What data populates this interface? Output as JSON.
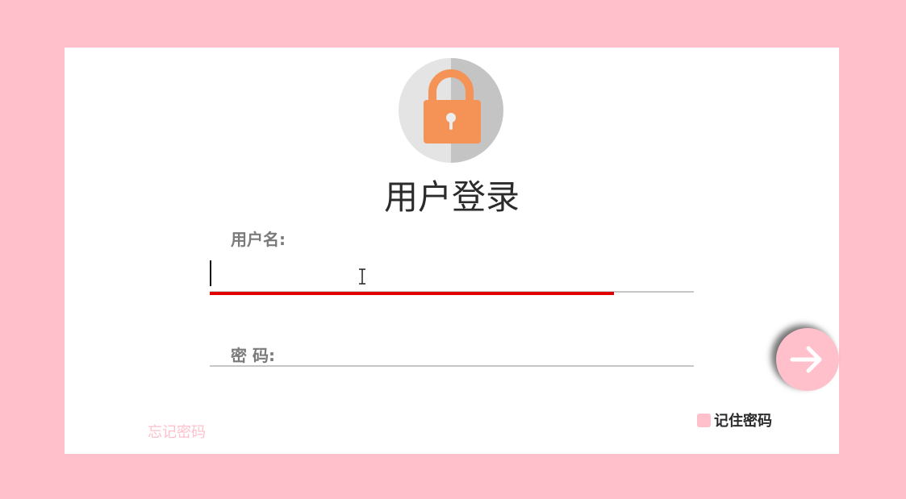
{
  "login": {
    "title": "用户登录",
    "username_label": "用户名:",
    "username_value": "",
    "username_placeholder": "",
    "password_label": "密 码:",
    "password_value": "",
    "remember_label": "记住密码",
    "remember_checked": false,
    "forgot_label": "忘记密码",
    "submit_icon": "arrow-right-icon",
    "avatar_icon": "padlock-icon",
    "username_focus_progress": 0.835
  },
  "colors": {
    "background": "#ffc0cb",
    "card": "#ffffff",
    "accent": "#ffc0cb",
    "focus_bar": "#e00000",
    "lock_body": "#f59356",
    "avatar_light": "#e4e4e4",
    "avatar_dark": "#c6c6c6"
  }
}
